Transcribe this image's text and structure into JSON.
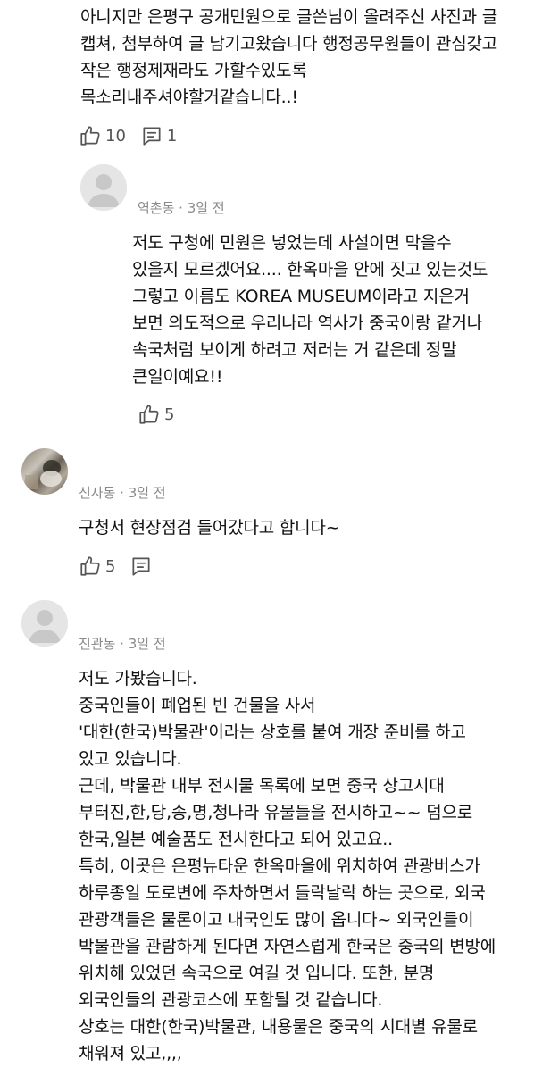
{
  "comments": [
    {
      "id": "c1",
      "text": "아니지만 은평구 공개민원으로 글쓴님이 올려주신 사진과 글\n캡쳐, 첨부하여 글 남기고왔습니다 행정공무원들이 관심갖고\n작은 행정제재라도 가할수있도록\n목소리내주셔야할거같습니다..!",
      "likes": "10",
      "replies": "1"
    },
    {
      "id": "c2",
      "author": "역촌동 · 3일 전",
      "text": "저도 구청에 민원은 넣었는데 사설이면 막을수\n있을지 모르겠어요.... 한옥마을 안에 짓고 있는것도\n그렇고 이름도 KOREA MUSEUM이라고 지은거\n보면 의도적으로 우리나라 역사가 중국이랑 같거나\n속국처럼 보이게 하려고 저러는 거 같은데 정말\n큰일이예요!!",
      "likes": "5"
    },
    {
      "id": "c3",
      "author": "신사동 · 3일 전",
      "text": "구청서 현장점검 들어갔다고 합니다~",
      "likes": "5"
    },
    {
      "id": "c4",
      "author": "진관동 · 3일 전",
      "text": "저도 가봤습니다.\n중국인들이 폐업된 빈 건물을 사서\n'대한(한국)박물관'이라는 상호를 붙여 개장 준비를 하고\n있고 있습니다.\n근데, 박물관 내부 전시물 목록에 보면 중국 상고시대\n부터진,한,당,송,명,청나라 유물들을 전시하고~~ 덤으로\n한국,일본 예술품도 전시한다고 되어 있고요..\n특히, 이곳은 은평뉴타운 한옥마을에 위치하여 관광버스가\n하루종일 도로변에 주차하면서 들락날락 하는 곳으로, 외국\n관광객들은 물론이고 내국인도 많이 옵니다~ 외국인들이\n박물관을 관람하게 된다면 자연스럽게 한국은 중국의 변방에\n위치해 있었던 속국으로 여길 것 입니다.  또한, 분명\n외국인들의 관광코스에 포함될 것 같습니다.\n상호는 대한(한국)박물관, 내용물은 중국의 시대별 유물로\n채워져 있고,,,,"
    }
  ],
  "colors": {
    "text": "#111111",
    "meta": "#8a8a8a",
    "icon": "#555555",
    "avatar_bg": "#e5e5e5",
    "avatar_fg": "#c8c8c8"
  }
}
